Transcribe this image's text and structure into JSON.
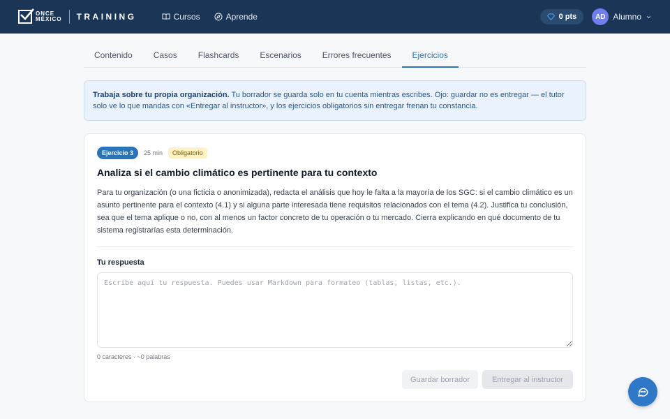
{
  "brand": {
    "logo_top": "ONCE",
    "logo_bottom": "MÉXICO",
    "product": "TRAINING"
  },
  "nav": {
    "courses": "Cursos",
    "learn": "Aprende"
  },
  "points": "0 pts",
  "user": {
    "initials": "AD",
    "name": "Alumno"
  },
  "tabs": [
    {
      "label": "Contenido"
    },
    {
      "label": "Casos"
    },
    {
      "label": "Flashcards"
    },
    {
      "label": "Escenarios"
    },
    {
      "label": "Errores frecuentes"
    },
    {
      "label": "Ejercicios",
      "active": true
    }
  ],
  "info": {
    "strong": "Trabaja sobre tu propia organización.",
    "text": " Tu borrador se guarda solo en tu cuenta mientras escribes. Ojo: guardar no es entregar — el tutor solo ve lo que mandas con «Entregar al instructor», y los ejercicios obligatorios sin entregar frenan tu constancia."
  },
  "exercise": {
    "badge": "Ejercicio 3",
    "duration": "25 min",
    "required": "Obligatorio",
    "title": "Analiza si el cambio climático es pertinente para tu contexto",
    "description": "Para tu organización (o una ficticia o anonimizada), redacta el análisis que hoy le falta a la mayoría de los SGC: si el cambio climático es un asunto pertinente para el contexto (4.1) y si alguna parte interesada tiene requisitos relacionados con el tema (4.2). Justifica tu conclusión, sea que el tema aplique o no, con al menos un factor concreto de tu operación o tu mercado. Cierra explicando en qué documento de tu sistema registrarías esta determinación."
  },
  "answer": {
    "label": "Tu respuesta",
    "value": "",
    "placeholder": "Escribe aquí tu respuesta. Puedes usar Markdown para formateo (tablas, listas, etc.).",
    "counter": "0 caracteres · ~0 palabras"
  },
  "buttons": {
    "save_draft": "Guardar borrador",
    "submit": "Entregar al instructor"
  },
  "icons": {
    "courses": "book-open-icon",
    "learn": "compass-icon",
    "points": "gem-icon",
    "user_menu": "chevron-down-icon",
    "chat": "chat-bubble-icon"
  },
  "colors": {
    "navbar": "#1b3556",
    "accent": "#2b73b8",
    "required_badge": "#fdf2c4",
    "fab": "#2f78c8"
  }
}
